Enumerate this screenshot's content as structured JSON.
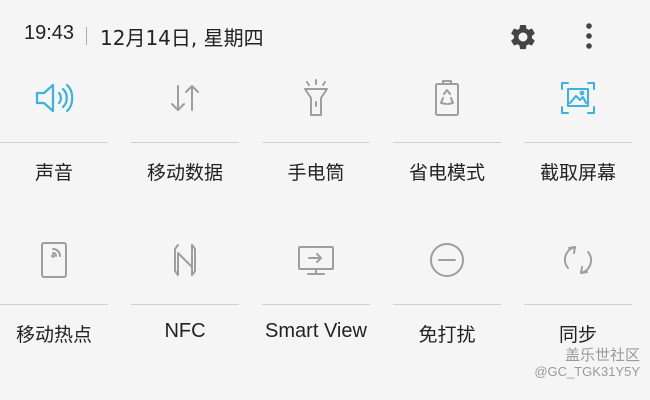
{
  "status_bar": {
    "time": "19:43",
    "date": "12月14日, 星期四",
    "settings_icon": "gear-icon",
    "more_icon": "more-vertical-icon"
  },
  "accent_color": "#3fb1df",
  "inactive_color": "#9e9e9e",
  "tiles_row1": [
    {
      "label": "声音",
      "icon": "speaker-icon",
      "active": true
    },
    {
      "label": "移动数据",
      "icon": "mobile-data-icon",
      "active": false
    },
    {
      "label": "手电筒",
      "icon": "flashlight-icon",
      "active": false
    },
    {
      "label": "省电模式",
      "icon": "power-saving-icon",
      "active": false
    },
    {
      "label": "截取屏幕",
      "icon": "screenshot-icon",
      "active": true
    }
  ],
  "tiles_row2": [
    {
      "label": "移动热点",
      "icon": "hotspot-icon",
      "active": false
    },
    {
      "label": "NFC",
      "icon": "nfc-icon",
      "active": false
    },
    {
      "label": "Smart View",
      "icon": "smart-view-icon",
      "active": false
    },
    {
      "label": "免打扰",
      "icon": "do-not-disturb-icon",
      "active": false
    },
    {
      "label": "同步",
      "icon": "sync-icon",
      "active": false
    }
  ],
  "watermark": {
    "brand": "盖乐世社区",
    "handle": "@GC_TGK31Y5Y"
  }
}
